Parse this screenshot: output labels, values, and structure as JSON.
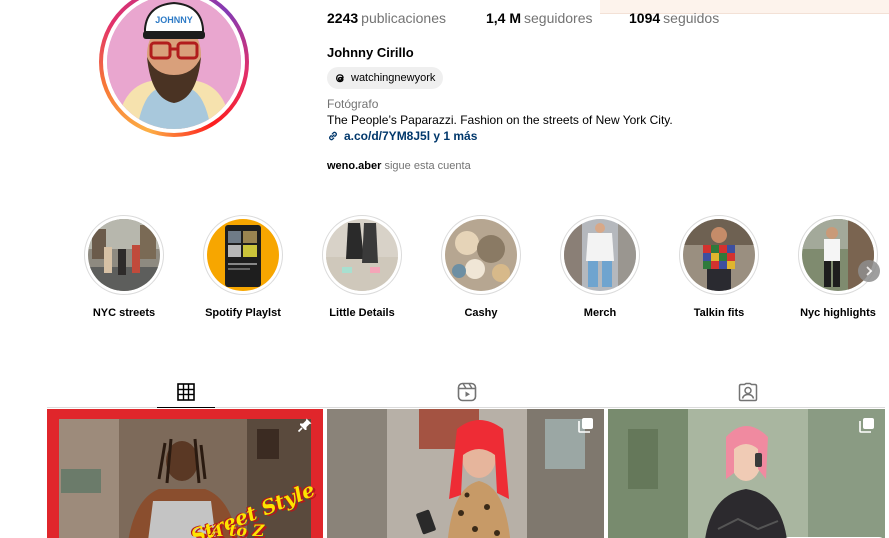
{
  "profile": {
    "name": "Johnny Cirillo",
    "stats": {
      "posts_value": "2243",
      "posts_label": "publicaciones",
      "followers_value": "1,4 M",
      "followers_label": "seguidores",
      "following_value": "1094",
      "following_label": "seguidos"
    },
    "threads_handle": "watchingnewyork",
    "category": "Fotógrafo",
    "bio": "The People’s Paparazzi. Fashion on the streets of New York City.",
    "link_text": "a.co/d/7YM8J5l y 1 más",
    "followed_by_user": "weno.aber",
    "followed_by_text": "sigue esta cuenta",
    "avatar_text": "JOHNNY"
  },
  "highlights": [
    {
      "label": "NYC streets"
    },
    {
      "label": "Spotify Playlst"
    },
    {
      "label": "Little Details"
    },
    {
      "label": "Cashy"
    },
    {
      "label": "Merch"
    },
    {
      "label": "Talkin fits"
    },
    {
      "label": "Nyc highlights"
    }
  ],
  "tabs": [
    {
      "icon": "grid-icon",
      "active": true
    },
    {
      "icon": "reels-icon",
      "active": false
    },
    {
      "icon": "tagged-icon",
      "active": false
    }
  ],
  "posts": [
    {
      "caption_line1": "Street Style",
      "caption_line2": "A to Z",
      "badge": "pin-icon"
    },
    {
      "badge": "carousel-icon"
    },
    {
      "badge": "carousel-icon"
    }
  ],
  "colors": {
    "link": "#00376b",
    "secondary_text": "#737373",
    "post1_frame": "#e0262b",
    "hair": "#ee2c35"
  }
}
